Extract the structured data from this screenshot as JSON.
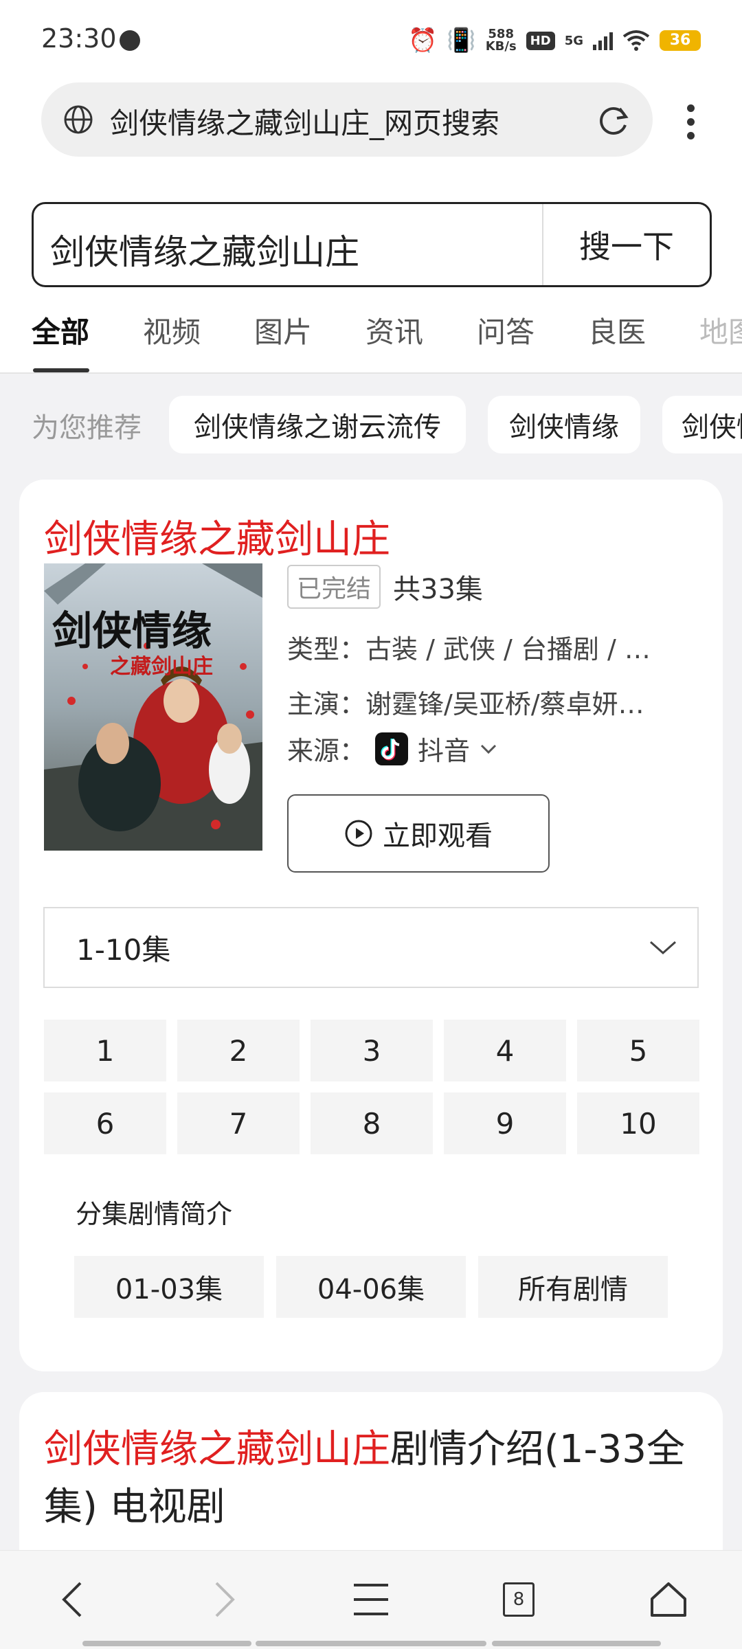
{
  "status": {
    "time": "23:30",
    "net_speed_value": "588",
    "net_speed_unit": "KB/s",
    "hd": "HD",
    "network": "5G",
    "battery": "36"
  },
  "browser": {
    "address_text": "剑侠情缘之藏剑山庄_网页搜索",
    "tab_count": "8"
  },
  "search": {
    "query": "剑侠情缘之藏剑山庄",
    "button_label": "搜一下"
  },
  "tabs": [
    "全部",
    "视频",
    "图片",
    "资讯",
    "问答",
    "良医",
    "地图"
  ],
  "recommend": {
    "label": "为您推荐",
    "chips": [
      "剑侠情缘之谢云流传",
      "剑侠情缘",
      "剑侠情缘"
    ]
  },
  "result": {
    "title": "剑侠情缘之藏剑山庄",
    "status_badge": "已完结",
    "episode_count": "共33集",
    "genre_label": "类型：",
    "genre_value": "古装 / 武侠 / 台播剧 / …",
    "cast_label": "主演：",
    "cast_value": "谢霆锋/吴亚桥/蔡卓妍…",
    "source_label": "来源：",
    "source_value": "抖音",
    "watch_label": "立即观看",
    "poster_title_line1": "剑侠情缘",
    "poster_title_line2": "之藏剑山庄",
    "range_label": "1-10集",
    "episodes": [
      "1",
      "2",
      "3",
      "4",
      "5",
      "6",
      "7",
      "8",
      "9",
      "10"
    ],
    "synopsis_label": "分集剧情简介",
    "synopsis_buttons": [
      "01-03集",
      "04-06集",
      "所有剧情"
    ]
  },
  "result2": {
    "title_red": "剑侠情缘之藏剑山庄",
    "title_rest": "剧情介绍(1-33全集) 电视剧"
  },
  "colors": {
    "accent_red": "#e02020",
    "battery": "#f0b400"
  }
}
